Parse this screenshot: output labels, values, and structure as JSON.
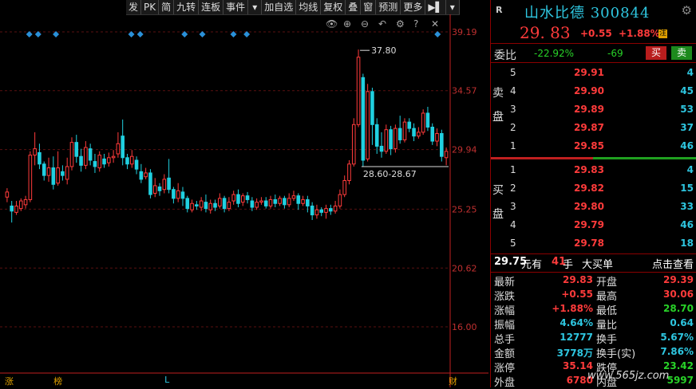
{
  "toolbar": [
    {
      "label": "发",
      "name": "tb-fa"
    },
    {
      "label": "PK",
      "name": "tb-pk"
    },
    {
      "label": "简",
      "name": "tb-jian"
    },
    {
      "label": "九转",
      "name": "tb-jiuzhuan"
    },
    {
      "label": "连板",
      "name": "tb-lianban"
    },
    {
      "label": "事件",
      "name": "tb-shijian"
    },
    {
      "label": "▾",
      "name": "tb-shijian-dropdown"
    },
    {
      "label": "加自选",
      "name": "tb-add-watchlist"
    },
    {
      "label": "均线",
      "name": "tb-ma"
    },
    {
      "label": "复权",
      "name": "tb-fuquan"
    },
    {
      "label": "叠",
      "name": "tb-overlay"
    },
    {
      "label": "窗",
      "name": "tb-window"
    },
    {
      "label": "预测",
      "name": "tb-forecast"
    },
    {
      "label": "更多",
      "name": "tb-more"
    },
    {
      "label": "▶▌",
      "name": "tb-expand"
    },
    {
      "label": "▾",
      "name": "tb-expand-dropdown"
    }
  ],
  "chart_data": {
    "type": "candlestick",
    "y_ticks": [
      "39.19",
      "34.57",
      "29.94",
      "25.25",
      "20.62",
      "16.00"
    ],
    "annotation_high": "37.80",
    "annotation_low": "28.60-28.67",
    "colors": {
      "up": "#ff3b3b",
      "down": "#20d0e0",
      "grid": "#5a1010",
      "axis": "#c02020"
    },
    "candles": [
      {
        "o": 26.2,
        "c": 26.6,
        "h": 26.9,
        "l": 25.8
      },
      {
        "o": 25.5,
        "c": 25.1,
        "h": 25.9,
        "l": 24.2
      },
      {
        "o": 25.0,
        "c": 25.5,
        "h": 25.9,
        "l": 24.8
      },
      {
        "o": 25.3,
        "c": 25.9,
        "h": 26.1,
        "l": 25.1
      },
      {
        "o": 25.6,
        "c": 26.0,
        "h": 26.3,
        "l": 25.3
      },
      {
        "o": 26.0,
        "c": 29.5,
        "h": 29.8,
        "l": 25.8
      },
      {
        "o": 29.5,
        "c": 30.0,
        "h": 31.3,
        "l": 28.7
      },
      {
        "o": 29.7,
        "c": 28.8,
        "h": 30.4,
        "l": 28.4
      },
      {
        "o": 28.8,
        "c": 27.9,
        "h": 29.0,
        "l": 27.5
      },
      {
        "o": 27.9,
        "c": 28.5,
        "h": 29.3,
        "l": 27.4
      },
      {
        "o": 28.5,
        "c": 27.2,
        "h": 29.4,
        "l": 26.8
      },
      {
        "o": 27.3,
        "c": 28.5,
        "h": 29.8,
        "l": 27.1
      },
      {
        "o": 28.2,
        "c": 27.9,
        "h": 28.7,
        "l": 27.5
      },
      {
        "o": 27.6,
        "c": 28.6,
        "h": 29.3,
        "l": 27.2
      },
      {
        "o": 28.6,
        "c": 30.5,
        "h": 30.9,
        "l": 28.3
      },
      {
        "o": 30.5,
        "c": 29.4,
        "h": 31.1,
        "l": 28.9
      },
      {
        "o": 29.4,
        "c": 28.7,
        "h": 30.0,
        "l": 28.2
      },
      {
        "o": 28.7,
        "c": 30.1,
        "h": 30.6,
        "l": 28.4
      },
      {
        "o": 30.0,
        "c": 29.1,
        "h": 30.4,
        "l": 28.7
      },
      {
        "o": 29.0,
        "c": 28.6,
        "h": 29.6,
        "l": 28.1
      },
      {
        "o": 28.5,
        "c": 29.5,
        "h": 29.8,
        "l": 28.2
      },
      {
        "o": 29.2,
        "c": 28.8,
        "h": 29.6,
        "l": 28.5
      },
      {
        "o": 28.9,
        "c": 29.3,
        "h": 29.7,
        "l": 28.6
      },
      {
        "o": 29.3,
        "c": 29.4,
        "h": 29.9,
        "l": 28.9
      },
      {
        "o": 29.6,
        "c": 30.4,
        "h": 31.3,
        "l": 29.3
      },
      {
        "o": 31.0,
        "c": 29.3,
        "h": 32.3,
        "l": 28.7
      },
      {
        "o": 29.3,
        "c": 28.8,
        "h": 29.6,
        "l": 28.4
      },
      {
        "o": 28.8,
        "c": 29.4,
        "h": 29.9,
        "l": 28.5
      },
      {
        "o": 29.1,
        "c": 28.4,
        "h": 29.4,
        "l": 28.0
      },
      {
        "o": 28.2,
        "c": 27.6,
        "h": 28.8,
        "l": 27.3
      },
      {
        "o": 27.8,
        "c": 28.1,
        "h": 28.5,
        "l": 27.6
      },
      {
        "o": 28.1,
        "c": 26.4,
        "h": 28.4,
        "l": 26.1
      },
      {
        "o": 26.5,
        "c": 27.1,
        "h": 27.7,
        "l": 26.2
      },
      {
        "o": 27.0,
        "c": 26.7,
        "h": 27.3,
        "l": 26.3
      },
      {
        "o": 26.8,
        "c": 27.6,
        "h": 28.0,
        "l": 26.5
      },
      {
        "o": 27.7,
        "c": 26.8,
        "h": 29.2,
        "l": 26.5
      },
      {
        "o": 26.8,
        "c": 26.1,
        "h": 27.0,
        "l": 25.7
      },
      {
        "o": 26.1,
        "c": 26.7,
        "h": 27.3,
        "l": 25.8
      },
      {
        "o": 26.6,
        "c": 26.1,
        "h": 27.0,
        "l": 25.5
      },
      {
        "o": 26.1,
        "c": 25.3,
        "h": 26.3,
        "l": 25.0
      },
      {
        "o": 25.2,
        "c": 25.7,
        "h": 26.0,
        "l": 25.0
      },
      {
        "o": 25.6,
        "c": 25.5,
        "h": 25.9,
        "l": 25.2
      },
      {
        "o": 25.4,
        "c": 25.9,
        "h": 26.2,
        "l": 25.1
      },
      {
        "o": 25.8,
        "c": 25.3,
        "h": 26.4,
        "l": 25.0
      },
      {
        "o": 25.2,
        "c": 25.7,
        "h": 26.0,
        "l": 24.9
      },
      {
        "o": 25.7,
        "c": 25.4,
        "h": 26.0,
        "l": 25.1
      },
      {
        "o": 25.5,
        "c": 26.1,
        "h": 26.5,
        "l": 25.3
      },
      {
        "o": 26.1,
        "c": 25.3,
        "h": 26.3,
        "l": 25.0
      },
      {
        "o": 25.3,
        "c": 25.8,
        "h": 26.2,
        "l": 25.1
      },
      {
        "o": 25.9,
        "c": 26.4,
        "h": 26.7,
        "l": 25.6
      },
      {
        "o": 26.4,
        "c": 25.7,
        "h": 26.8,
        "l": 25.4
      },
      {
        "o": 25.8,
        "c": 26.3,
        "h": 26.5,
        "l": 25.5
      },
      {
        "o": 26.3,
        "c": 26.0,
        "h": 26.6,
        "l": 25.7
      },
      {
        "o": 25.9,
        "c": 25.4,
        "h": 26.2,
        "l": 25.1
      },
      {
        "o": 25.4,
        "c": 25.8,
        "h": 26.1,
        "l": 25.2
      },
      {
        "o": 25.8,
        "c": 25.9,
        "h": 26.2,
        "l": 25.6
      },
      {
        "o": 25.9,
        "c": 25.5,
        "h": 26.2,
        "l": 25.3
      },
      {
        "o": 25.5,
        "c": 26.0,
        "h": 26.3,
        "l": 25.3
      },
      {
        "o": 26.0,
        "c": 25.7,
        "h": 26.4,
        "l": 25.4
      },
      {
        "o": 25.7,
        "c": 26.1,
        "h": 26.3,
        "l": 25.5
      },
      {
        "o": 26.1,
        "c": 25.6,
        "h": 26.3,
        "l": 25.3
      },
      {
        "o": 25.6,
        "c": 26.1,
        "h": 26.5,
        "l": 25.4
      },
      {
        "o": 26.1,
        "c": 26.3,
        "h": 26.7,
        "l": 25.9
      },
      {
        "o": 26.3,
        "c": 25.7,
        "h": 26.5,
        "l": 25.2
      },
      {
        "o": 25.7,
        "c": 26.0,
        "h": 26.3,
        "l": 25.5
      },
      {
        "o": 26.0,
        "c": 25.5,
        "h": 26.3,
        "l": 25.0
      },
      {
        "o": 25.5,
        "c": 24.8,
        "h": 25.8,
        "l": 24.4
      },
      {
        "o": 24.8,
        "c": 25.2,
        "h": 25.6,
        "l": 24.5
      },
      {
        "o": 25.2,
        "c": 25.0,
        "h": 25.4,
        "l": 24.7
      },
      {
        "o": 25.0,
        "c": 25.3,
        "h": 25.6,
        "l": 24.5
      },
      {
        "o": 25.3,
        "c": 25.1,
        "h": 25.6,
        "l": 24.8
      },
      {
        "o": 25.1,
        "c": 25.5,
        "h": 25.9,
        "l": 24.9
      },
      {
        "o": 25.5,
        "c": 26.4,
        "h": 26.8,
        "l": 25.3
      },
      {
        "o": 26.4,
        "c": 27.5,
        "h": 27.9,
        "l": 26.2
      },
      {
        "o": 27.5,
        "c": 28.8,
        "h": 29.1,
        "l": 27.2
      },
      {
        "o": 28.8,
        "c": 31.9,
        "h": 32.4,
        "l": 28.6
      },
      {
        "o": 31.9,
        "c": 37.2,
        "h": 37.8,
        "l": 31.7
      },
      {
        "o": 35.6,
        "c": 29.1,
        "h": 35.9,
        "l": 28.6
      },
      {
        "o": 29.2,
        "c": 34.5,
        "h": 35.1,
        "l": 29.0
      },
      {
        "o": 34.5,
        "c": 31.9,
        "h": 34.8,
        "l": 30.3
      },
      {
        "o": 31.9,
        "c": 30.2,
        "h": 32.4,
        "l": 29.6
      },
      {
        "o": 30.2,
        "c": 29.8,
        "h": 31.3,
        "l": 29.3
      },
      {
        "o": 29.8,
        "c": 31.5,
        "h": 31.9,
        "l": 29.6
      },
      {
        "o": 31.5,
        "c": 30.0,
        "h": 31.8,
        "l": 29.5
      },
      {
        "o": 30.0,
        "c": 31.6,
        "h": 31.9,
        "l": 29.7
      },
      {
        "o": 31.6,
        "c": 30.7,
        "h": 32.6,
        "l": 30.4
      },
      {
        "o": 30.7,
        "c": 32.1,
        "h": 32.4,
        "l": 30.5
      },
      {
        "o": 32.1,
        "c": 31.6,
        "h": 32.4,
        "l": 31.3
      },
      {
        "o": 31.6,
        "c": 31.0,
        "h": 32.0,
        "l": 30.6
      },
      {
        "o": 31.0,
        "c": 31.3,
        "h": 31.7,
        "l": 30.8
      },
      {
        "o": 31.3,
        "c": 32.8,
        "h": 33.1,
        "l": 31.1
      },
      {
        "o": 32.8,
        "c": 31.7,
        "h": 33.3,
        "l": 31.4
      },
      {
        "o": 31.7,
        "c": 30.6,
        "h": 32.0,
        "l": 30.3
      },
      {
        "o": 30.6,
        "c": 31.2,
        "h": 31.6,
        "l": 30.2
      },
      {
        "o": 31.2,
        "c": 29.4,
        "h": 31.5,
        "l": 29.0
      },
      {
        "o": 29.3,
        "c": 29.8,
        "h": 30.1,
        "l": 28.7
      }
    ]
  },
  "markers_top": [
    {
      "at": 5
    },
    {
      "at": 7
    },
    {
      "at": 11
    },
    {
      "at": 28
    },
    {
      "at": 30
    },
    {
      "at": 40
    },
    {
      "at": 44
    },
    {
      "at": 51
    },
    {
      "at": 54
    },
    {
      "at": 97
    }
  ],
  "bottom_labels": [
    {
      "text": "涨",
      "color": "#e0a000",
      "at": 0
    },
    {
      "text": "榜",
      "color": "#e0a000",
      "at": 11
    },
    {
      "text": "L",
      "color": "#2ec6e0",
      "at": 36
    },
    {
      "text": "财",
      "color": "#e0a000",
      "at": 100
    }
  ],
  "stock": {
    "badge": "R",
    "name": "山水比德",
    "code": "300844",
    "price": "29. 83",
    "change": "+0.55",
    "pct": "+1.88%",
    "tag": "注"
  },
  "wei": {
    "label": "委比",
    "ratio": "-22.92%",
    "diff": "-69",
    "buy": "买",
    "sell": "卖"
  },
  "sell_side_label": [
    "卖",
    "盘"
  ],
  "buy_side_label": [
    "买",
    "盘"
  ],
  "asks": [
    {
      "lvl": "5",
      "px": "29.91",
      "vol": "4"
    },
    {
      "lvl": "4",
      "px": "29.90",
      "vol": "45"
    },
    {
      "lvl": "3",
      "px": "29.89",
      "vol": "53"
    },
    {
      "lvl": "2",
      "px": "29.87",
      "vol": "37"
    },
    {
      "lvl": "1",
      "px": "29.85",
      "vol": "46"
    }
  ],
  "bids": [
    {
      "lvl": "1",
      "px": "29.83",
      "vol": "4"
    },
    {
      "lvl": "2",
      "px": "29.82",
      "vol": "15"
    },
    {
      "lvl": "3",
      "px": "29.80",
      "vol": "33"
    },
    {
      "lvl": "4",
      "px": "29.79",
      "vol": "46"
    },
    {
      "lvl": "5",
      "px": "29.78",
      "vol": "18"
    }
  ],
  "bigorder": {
    "price": "29.75",
    "unit": "元有",
    "vol": "41",
    "shou": "手",
    "title": "大买单",
    "link": "点击查看"
  },
  "stats": [
    {
      "l1": "最新",
      "v1": "29.83",
      "c1": "red",
      "l2": "开盘",
      "v2": "29.39",
      "c2": "red"
    },
    {
      "l1": "涨跌",
      "v1": "+0.55",
      "c1": "red",
      "l2": "最高",
      "v2": "30.06",
      "c2": "red"
    },
    {
      "l1": "涨幅",
      "v1": "+1.88%",
      "c1": "red",
      "l2": "最低",
      "v2": "28.70",
      "c2": "green"
    },
    {
      "l1": "振幅",
      "v1": "4.64%",
      "c1": "cyan",
      "l2": "量比",
      "v2": "0.64",
      "c2": "cyan"
    },
    {
      "l1": "总手",
      "v1": "12777",
      "c1": "cyan",
      "l2": "换手",
      "v2": "5.67%",
      "c2": "cyan"
    },
    {
      "l1": "金额",
      "v1": "3778万",
      "c1": "cyan",
      "l2": "换手(实)",
      "v2": "7.86%",
      "c2": "cyan"
    },
    {
      "l1": "涨停",
      "v1": "35.14",
      "c1": "red",
      "l2": "跌停",
      "v2": "23.42",
      "c2": "green"
    },
    {
      "l1": "外盘",
      "v1": "6780",
      "c1": "red",
      "l2": "内盘",
      "v2": "5997",
      "c2": "green"
    }
  ],
  "watermark": "www.565jz.com"
}
